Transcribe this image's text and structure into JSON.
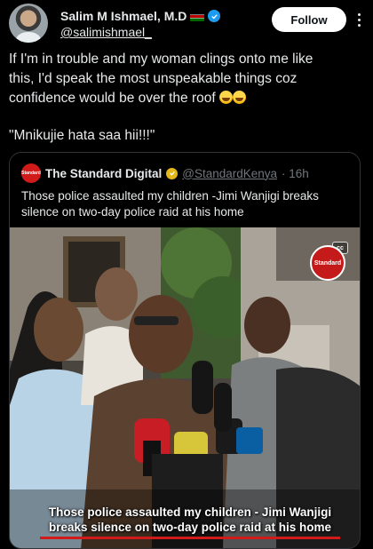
{
  "post": {
    "author": {
      "display_name": "Salim M Ishmael, M.D",
      "handle": "@salimishmael_"
    },
    "follow_label": "Follow",
    "text_line1": "If I'm in trouble and my woman clings onto me like",
    "text_line2": "this, I'd speak the most unspeakable things coz",
    "text_line3": "confidence would be over the roof",
    "quote_line": "\"Mnikujie hata saa hii!!!\""
  },
  "quoted": {
    "display_name": "The Standard Digital",
    "handle": "@StandardKenya",
    "time": "· 16h",
    "avatar_text": "Standard",
    "text_line1": "Those police assaulted my children -Jimi Wanjigi breaks",
    "text_line2": "silence on two-day police raid at his home",
    "media": {
      "cc_label": "cc",
      "logo_text": "Standard",
      "caption_line1": "Those police assaulted my children - Jimi Wanjigi",
      "caption_line2": "breaks silence on two-day police raid at his home"
    }
  },
  "icons": [
    "kenya-flag-icon",
    "verified-badge-icon",
    "more-options-icon",
    "gold-verified-badge-icon",
    "closed-caption-icon"
  ],
  "colors": {
    "background": "#000000",
    "text": "#e7e9ea",
    "muted": "#71767b",
    "verified": "#1d9bf0",
    "gold": "#e2b719",
    "brand_red": "#d11a1a"
  }
}
